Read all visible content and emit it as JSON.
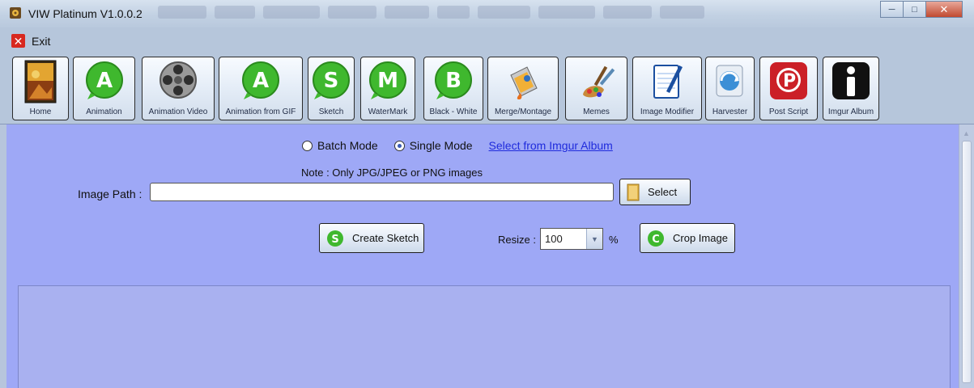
{
  "window": {
    "title": "VIW Platinum V1.0.0.2",
    "icons": {
      "app": "film-reel-icon"
    }
  },
  "menu": {
    "exit_label": "Exit",
    "exit_icon": "close-icon",
    "exit_color": "#d8281f"
  },
  "toolbar": {
    "items": [
      {
        "label": "Home",
        "icon": "home-image-icon"
      },
      {
        "label": "Animation",
        "icon": "green-a-icon"
      },
      {
        "label": "Animation Video",
        "icon": "film-reel-icon"
      },
      {
        "label": "Animation from GIF",
        "icon": "green-a-icon"
      },
      {
        "label": "Sketch",
        "icon": "green-s-icon"
      },
      {
        "label": "WaterMark",
        "icon": "green-m-icon"
      },
      {
        "label": "Black - White",
        "icon": "green-b-icon"
      },
      {
        "label": "Merge/Montage",
        "icon": "paint-bucket-icon"
      },
      {
        "label": "Memes",
        "icon": "paint-brushes-icon"
      },
      {
        "label": "Image Modifier",
        "icon": "notepad-pen-icon"
      },
      {
        "label": "Harvester",
        "icon": "globe-refresh-icon"
      },
      {
        "label": "Post Script",
        "icon": "pinterest-icon"
      },
      {
        "label": "Imgur Album",
        "icon": "info-i-icon"
      }
    ]
  },
  "mode": {
    "batch_label": "Batch Mode",
    "single_label": "Single Mode",
    "selected": "Single Mode",
    "imgur_link": "Select from Imgur Album"
  },
  "form": {
    "note": "Note : Only JPG/JPEG or PNG images",
    "image_path_label": "Image Path :",
    "image_path_value": "",
    "select_label": "Select",
    "create_sketch_label": "Create Sketch",
    "resize_label": "Resize :",
    "resize_value": "100",
    "percent_label": "%",
    "crop_label": "Crop Image"
  },
  "colors": {
    "content_bg": "#9ea8f6",
    "icon_green": "#3fb82e",
    "link": "#1f2bdc",
    "pinterest_red": "#cb2027"
  }
}
